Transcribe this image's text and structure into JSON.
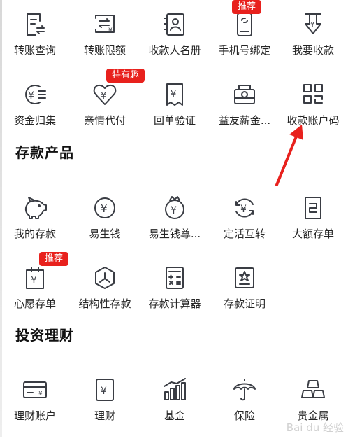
{
  "transfer_services": {
    "items": [
      {
        "label": "转账查询",
        "icon": "transfer-query-icon"
      },
      {
        "label": "转账限额",
        "icon": "transfer-limit-icon"
      },
      {
        "label": "收款人名册",
        "icon": "payee-list-icon"
      },
      {
        "label": "手机号绑定",
        "icon": "phone-binding-icon",
        "badge": "推荐"
      },
      {
        "label": "我要收款",
        "icon": "receive-money-icon"
      },
      {
        "label": "资金归集",
        "icon": "fund-collection-icon"
      },
      {
        "label": "亲情代付",
        "icon": "family-pay-icon",
        "badge": "特有趣"
      },
      {
        "label": "回单验证",
        "icon": "receipt-verify-icon"
      },
      {
        "label": "益友薪金...",
        "icon": "salary-icon"
      },
      {
        "label": "收款账户码",
        "icon": "account-qr-code-icon"
      }
    ]
  },
  "deposit_products": {
    "title": "存款产品",
    "items": [
      {
        "label": "我的存款",
        "icon": "piggy-bank-icon"
      },
      {
        "label": "易生钱",
        "icon": "yi-sheng-qian-icon"
      },
      {
        "label": "易生钱尊...",
        "icon": "yi-sheng-qian-premium-icon"
      },
      {
        "label": "定活互转",
        "icon": "fixed-demand-swap-icon"
      },
      {
        "label": "大额存单",
        "icon": "large-deposit-certificate-icon"
      },
      {
        "label": "心愿存单",
        "icon": "wish-deposit-icon",
        "badge": "推荐"
      },
      {
        "label": "结构性存款",
        "icon": "structured-deposit-icon"
      },
      {
        "label": "存款计算器",
        "icon": "calculator-icon"
      },
      {
        "label": "存款证明",
        "icon": "deposit-certificate-icon"
      }
    ]
  },
  "investment": {
    "title": "投资理财",
    "items": [
      {
        "label": "理财账户",
        "icon": "wealth-account-icon"
      },
      {
        "label": "理财",
        "icon": "wealth-management-icon"
      },
      {
        "label": "基金",
        "icon": "fund-chart-icon"
      },
      {
        "label": "保险",
        "icon": "umbrella-icon"
      },
      {
        "label": "贵金属",
        "icon": "gold-bars-icon"
      }
    ]
  },
  "annotation": {
    "arrow_color": "#e8211d",
    "points_to": "收款账户码"
  },
  "watermark": {
    "text": "Bai du 经验"
  },
  "colors": {
    "icon_stroke": "#3a3d44",
    "badge_bg": "#e8211d",
    "badge_text": "#ffffff"
  }
}
